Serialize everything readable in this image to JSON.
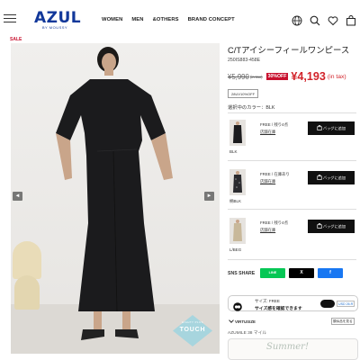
{
  "header": {
    "menu_icon": "hamburger-icon",
    "logo_main": "AZUL",
    "logo_sub": "BY MOUSSY",
    "nav": [
      "WOMEN",
      "MEN",
      "&OTHERS",
      "BRAND CONCEPT"
    ],
    "icons": [
      "globe-icon",
      "search-icon",
      "heart-icon",
      "bag-icon"
    ],
    "logo_color": "#12389a"
  },
  "sale_label": "SALE",
  "gallery": {
    "prev_arrow": "◄",
    "next_arrow": "►",
    "badge_top": "EIGHTY PLUS",
    "badge_text": "TOUCH"
  },
  "product": {
    "title": "C/Tアイシーフィールワンピース",
    "code": "250IS883-458E",
    "price_old": "¥5,990",
    "price_old_tax": "(in tax)",
    "discount": "30%OFF",
    "price_new": "¥4,193",
    "price_new_tax": "(in tax)",
    "coupon": "28UV10%OFF",
    "selected_color": "選択中のカラー：BLK",
    "price_color": "#d2232a"
  },
  "variants": [
    {
      "name": "BLK",
      "stock": "FREE / 残り4点",
      "store": "店舗在庫",
      "cart": "バッグに追加"
    },
    {
      "name": "柄BLK",
      "stock": "FREE / 在庫あり",
      "store": "店舗在庫",
      "cart": "バッグに追加"
    },
    {
      "name": "L/BEG",
      "stock": "FREE / 残り4点",
      "store": "店舗在庫",
      "cart": "バッグに追加"
    }
  ],
  "share": {
    "label": "SNS SHARE",
    "line": "LINE",
    "x": "X",
    "facebook": "f"
  },
  "virtusize": {
    "size": "サイズ: FREE",
    "note": "サイズ感を確認できます",
    "currency": "USD 26.R",
    "brand": "VIRTUSIZE",
    "link": "類似品を見る"
  },
  "miles": "AZUMILE 38 マイル",
  "banner_text": "Summer!"
}
